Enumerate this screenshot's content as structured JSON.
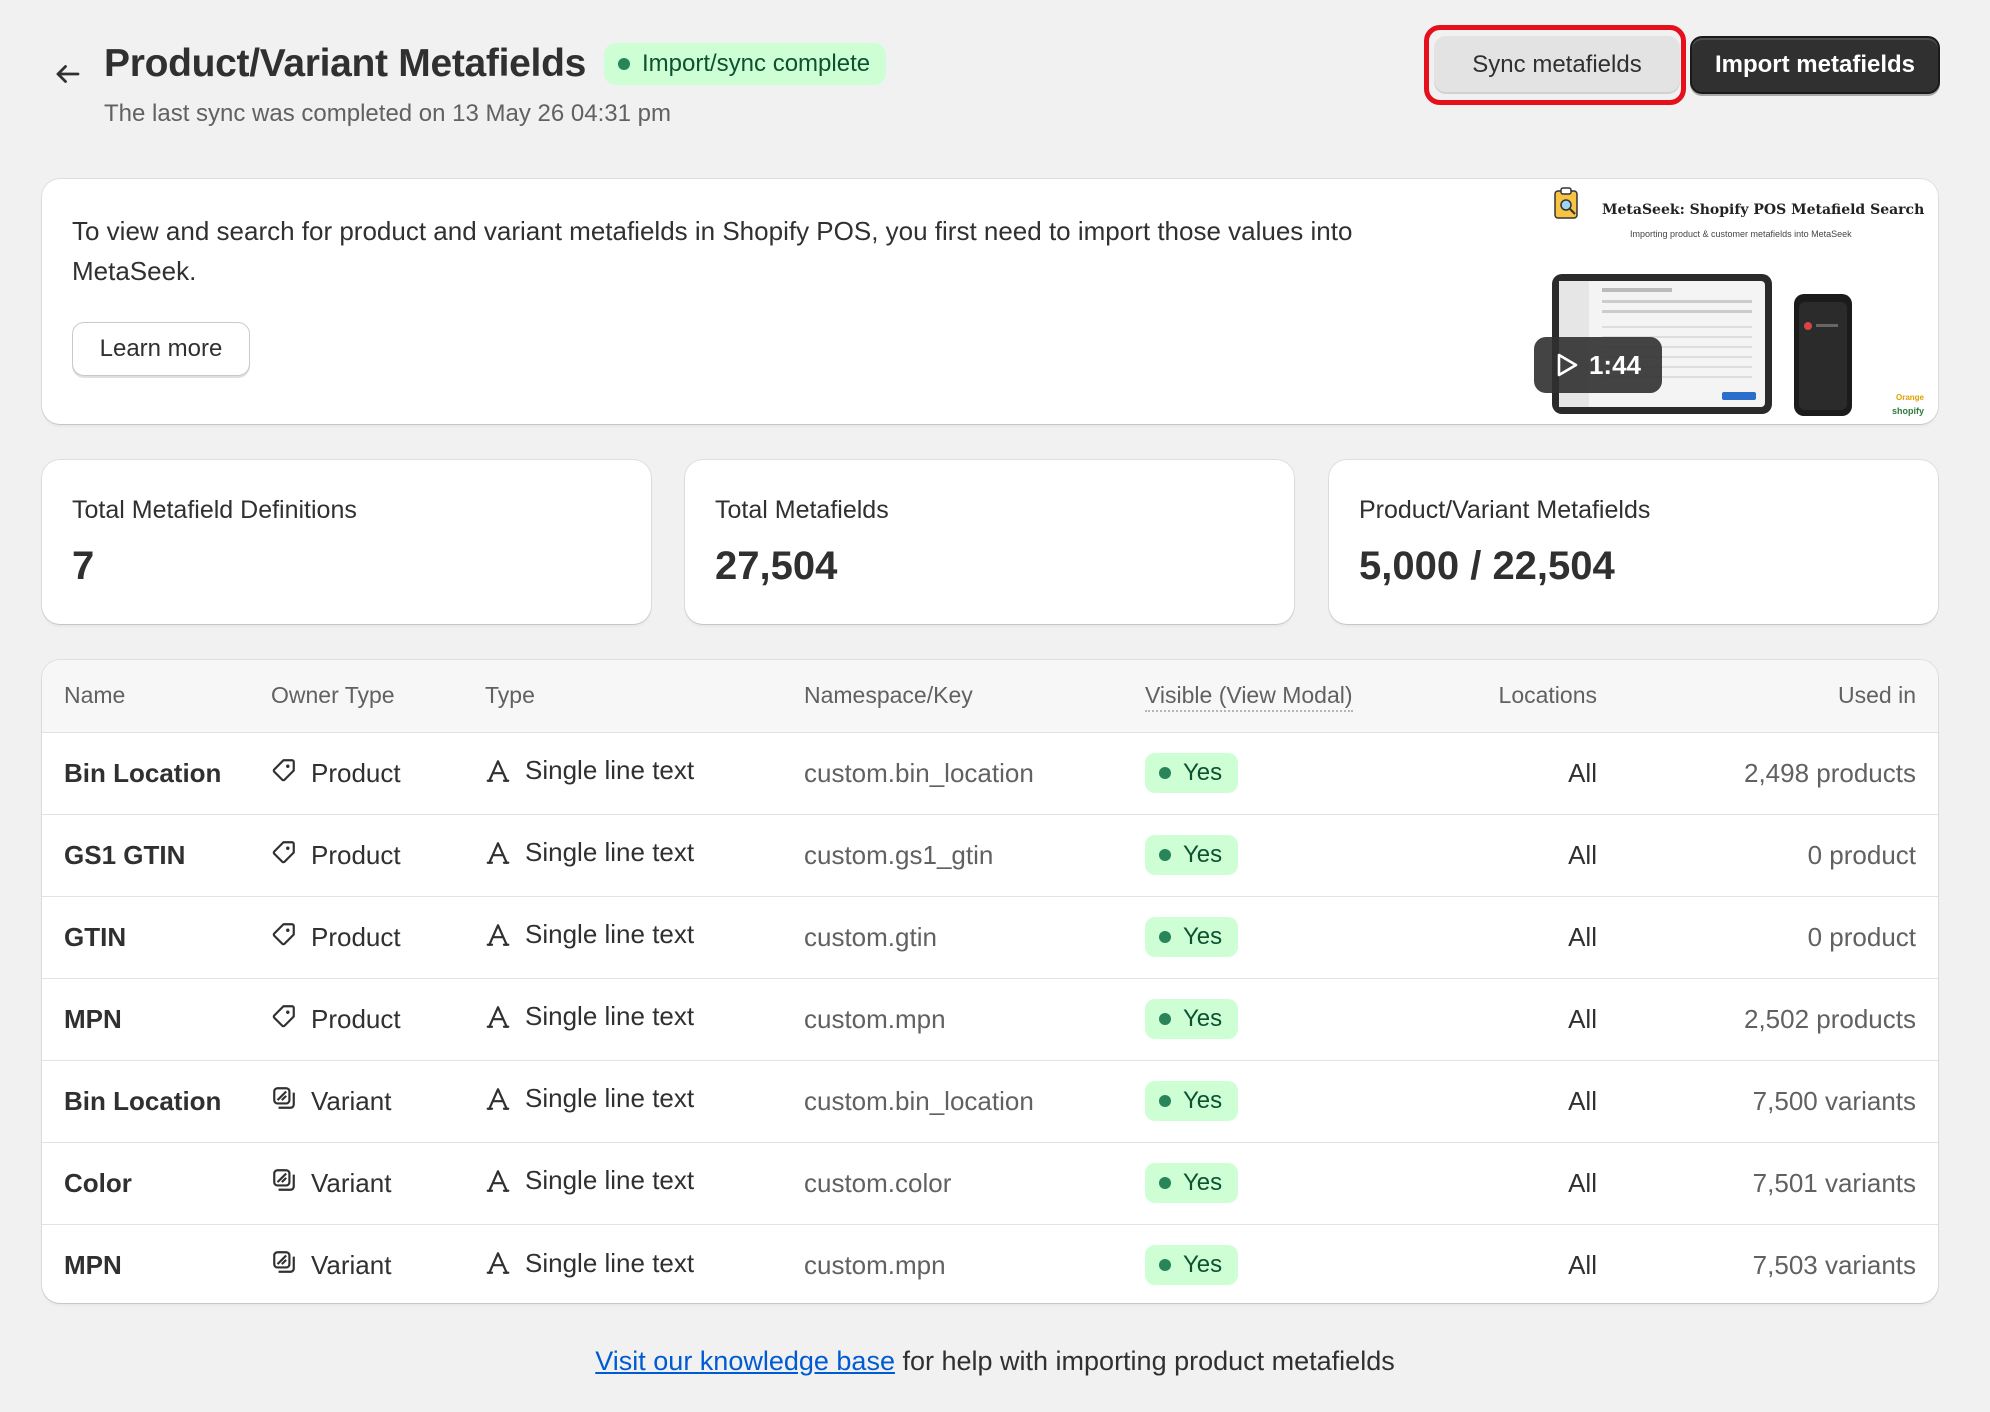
{
  "header": {
    "title": "Product/Variant Metafields",
    "status_badge": "Import/sync complete",
    "subtitle": "The last sync was completed on 13 May 26 04:31 pm",
    "sync_button": "Sync metafields",
    "import_button": "Import metafields"
  },
  "info_card": {
    "text": "To view and search for product and variant metafields in Shopify POS, you first need to import those values into MetaSeek.",
    "learn_more": "Learn more",
    "video": {
      "title": "MetaSeek: Shopify POS Metafield Search",
      "subtitle": "Importing product & customer metafields into MetaSeek",
      "duration": "1:44"
    }
  },
  "stats": [
    {
      "label": "Total Metafield Definitions",
      "value": "7"
    },
    {
      "label": "Total Metafields",
      "value": "27,504"
    },
    {
      "label": "Product/Variant Metafields",
      "value": "5,000 / 22,504"
    }
  ],
  "table": {
    "headers": {
      "name": "Name",
      "owner_type": "Owner Type",
      "type": "Type",
      "namespace_key": "Namespace/Key",
      "visible": "Visible (View Modal)",
      "locations": "Locations",
      "used_in": "Used in"
    },
    "rows": [
      {
        "name": "Bin Location",
        "owner": "Product",
        "type": "Single line text",
        "key": "custom.bin_location",
        "visible": "Yes",
        "locations": "All",
        "used_in": "2,498 products"
      },
      {
        "name": "GS1 GTIN",
        "owner": "Product",
        "type": "Single line text",
        "key": "custom.gs1_gtin",
        "visible": "Yes",
        "locations": "All",
        "used_in": "0 product"
      },
      {
        "name": "GTIN",
        "owner": "Product",
        "type": "Single line text",
        "key": "custom.gtin",
        "visible": "Yes",
        "locations": "All",
        "used_in": "0 product"
      },
      {
        "name": "MPN",
        "owner": "Product",
        "type": "Single line text",
        "key": "custom.mpn",
        "visible": "Yes",
        "locations": "All",
        "used_in": "2,502 products"
      },
      {
        "name": "Bin Location",
        "owner": "Variant",
        "type": "Single line text",
        "key": "custom.bin_location",
        "visible": "Yes",
        "locations": "All",
        "used_in": "7,500 variants"
      },
      {
        "name": "Color",
        "owner": "Variant",
        "type": "Single line text",
        "key": "custom.color",
        "visible": "Yes",
        "locations": "All",
        "used_in": "7,501 variants"
      },
      {
        "name": "MPN",
        "owner": "Variant",
        "type": "Single line text",
        "key": "custom.mpn",
        "visible": "Yes",
        "locations": "All",
        "used_in": "7,503 variants"
      }
    ]
  },
  "footer": {
    "link_text": "Visit our knowledge base",
    "rest_text": " for help with importing product metafields"
  },
  "icons": {
    "back": "arrow-left-icon",
    "product": "tag-icon",
    "variant": "variant-icon",
    "type": "text-type-icon",
    "play": "play-icon"
  },
  "colors": {
    "success_bg": "#cdfed4",
    "success_dot": "#29845a",
    "primary_button": "#303030",
    "highlight": "#e5101c",
    "link": "#005bd3"
  }
}
